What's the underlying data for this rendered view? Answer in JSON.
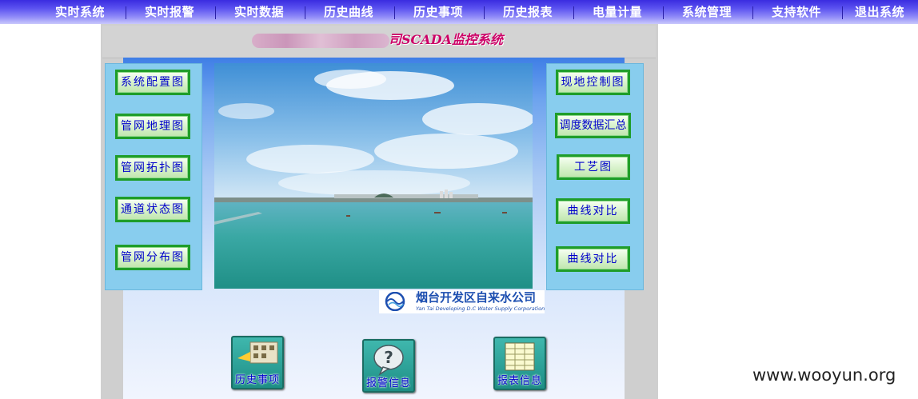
{
  "nav": {
    "items": [
      "实时系统",
      "实时报警",
      "实时数据",
      "历史曲线",
      "历史事项",
      "历史报表",
      "电量计量",
      "系统管理",
      "支持软件",
      "退出系统"
    ]
  },
  "header": {
    "title": "司SCADA监控系统"
  },
  "left_panel": {
    "buttons": [
      "系统配置图",
      "管网地理图",
      "管网拓扑图",
      "通道状态图",
      "管网分布图"
    ]
  },
  "right_panel": {
    "buttons": [
      "现地控制图",
      "调度数据汇总",
      "工艺图",
      "曲线对比",
      "曲线对比"
    ]
  },
  "logo": {
    "name_cn": "烟台开发区自来水公司",
    "name_en": "Yan Tai Developing D.C Water Supply Corporation"
  },
  "bottom_buttons": {
    "history_events": "历史事项",
    "alarm_info": "报警信息",
    "report_info": "报表信息"
  },
  "watermark": "www.wooyun.org",
  "colors": {
    "nav_bg": "#4a3fe8",
    "button_border": "#1f9d2a",
    "button_text": "#0000cc",
    "title": "#cc0066",
    "panel_bg": "#88cdee"
  }
}
